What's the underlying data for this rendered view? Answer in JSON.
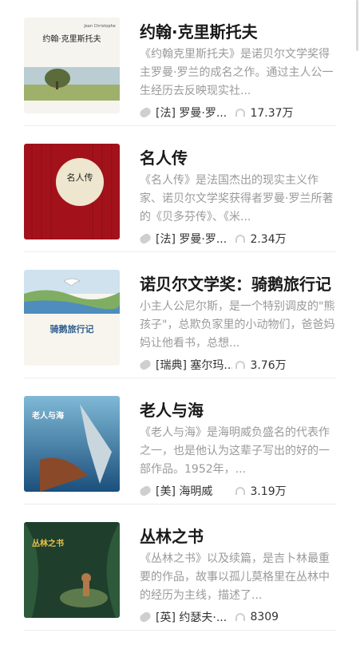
{
  "books": [
    {
      "title": "约翰·克里斯托夫",
      "desc": "《约翰克里斯托夫》是诺贝尔文学奖得主罗曼·罗兰的成名之作。通过主人公一生经历去反映现实社...",
      "author": "[法] 罗曼·罗...",
      "plays": "17.37万",
      "cover_title": "约翰·克里斯托夫",
      "cover_subtitle": "Jean Christophe"
    },
    {
      "title": "名人传",
      "desc": "《名人传》是法国杰出的现实主义作家、诺贝尔文学奖获得者罗曼·罗兰所著的《贝多芬传》、《米...",
      "author": "[法] 罗曼·罗...",
      "plays": "2.34万",
      "cover_title": "名人传"
    },
    {
      "title": "诺贝尔文学奖：骑鹅旅行记",
      "desc": "小主人公尼尔斯，是一个特别调皮的\"熊孩子\"，总欺负家里的小动物们，爸爸妈妈让他看书，总想...",
      "author": "[瑞典] 塞尔玛...",
      "plays": "3.76万",
      "cover_title": "骑鹅旅行记"
    },
    {
      "title": "老人与海",
      "desc": "《老人与海》是海明威负盛名的代表作之一，也是他认为这辈子写出的好的一部作品。1952年，...",
      "author": "[美] 海明威",
      "plays": "3.19万",
      "cover_title": "老人与海"
    },
    {
      "title": "丛林之书",
      "desc": "《丛林之书》以及续篇，是吉卜林最重要的作品，故事以孤儿莫格里在丛林中的经历为主线，描述了...",
      "author": "[英] 约瑟夫·...",
      "plays": "8309",
      "cover_title": "丛林之书"
    }
  ]
}
